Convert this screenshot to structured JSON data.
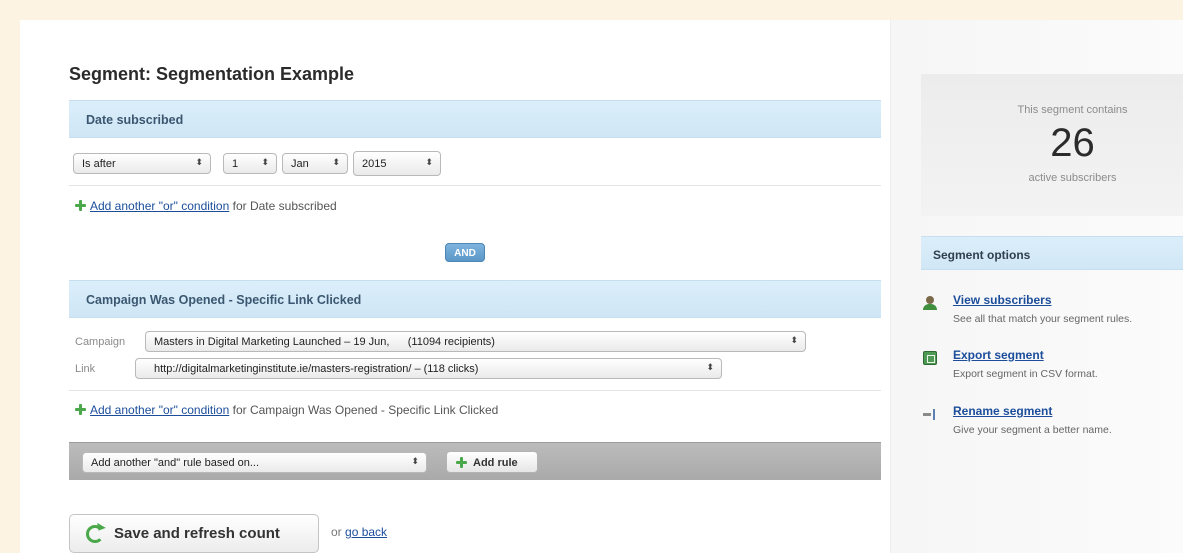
{
  "page": {
    "title": "Segment: Segmentation Example"
  },
  "date_rule": {
    "heading": "Date subscribed",
    "operator": "Is after",
    "day": "1",
    "month": "Jan",
    "year": "2015",
    "add_or_link": "Add another \"or\" condition",
    "add_or_suffix": "for Date subscribed"
  },
  "and_badge": "AND",
  "campaign_rule": {
    "heading": "Campaign Was Opened - Specific Link Clicked",
    "campaign_label": "Campaign",
    "campaign_value": "Masters in Digital Marketing Launched – 19 Jun,      (11094 recipients)",
    "link_label": "Link",
    "link_value": "http://digitalmarketinginstitute.ie/masters-registration/ – (118 clicks)",
    "add_or_link": "Add another \"or\" condition",
    "add_or_suffix": "for Campaign Was Opened - Specific Link Clicked"
  },
  "rule_bar": {
    "select_value": "Add another \"and\" rule based on...",
    "add_rule_label": "Add rule"
  },
  "actions": {
    "save_label": "Save and refresh count",
    "or_text": "or",
    "go_back_label": "go back"
  },
  "summary": {
    "caption": "This segment contains",
    "count": "26",
    "subcaption": "active subscribers"
  },
  "options": {
    "heading": "Segment options",
    "items": [
      {
        "title": "View subscribers",
        "desc": "See all that match your segment rules.",
        "icon": "person-icon"
      },
      {
        "title": "Export segment",
        "desc": "Export segment in CSV format.",
        "icon": "export-icon"
      },
      {
        "title": "Rename segment",
        "desc": "Give your segment a better name.",
        "icon": "rename-icon"
      }
    ]
  },
  "colors": {
    "page_background": "#fdf3e3",
    "section_header": "#d6ebf8",
    "link": "#1b4d9b",
    "and_badge": "#6ea7d4",
    "add_icon": "#4aa84a"
  }
}
